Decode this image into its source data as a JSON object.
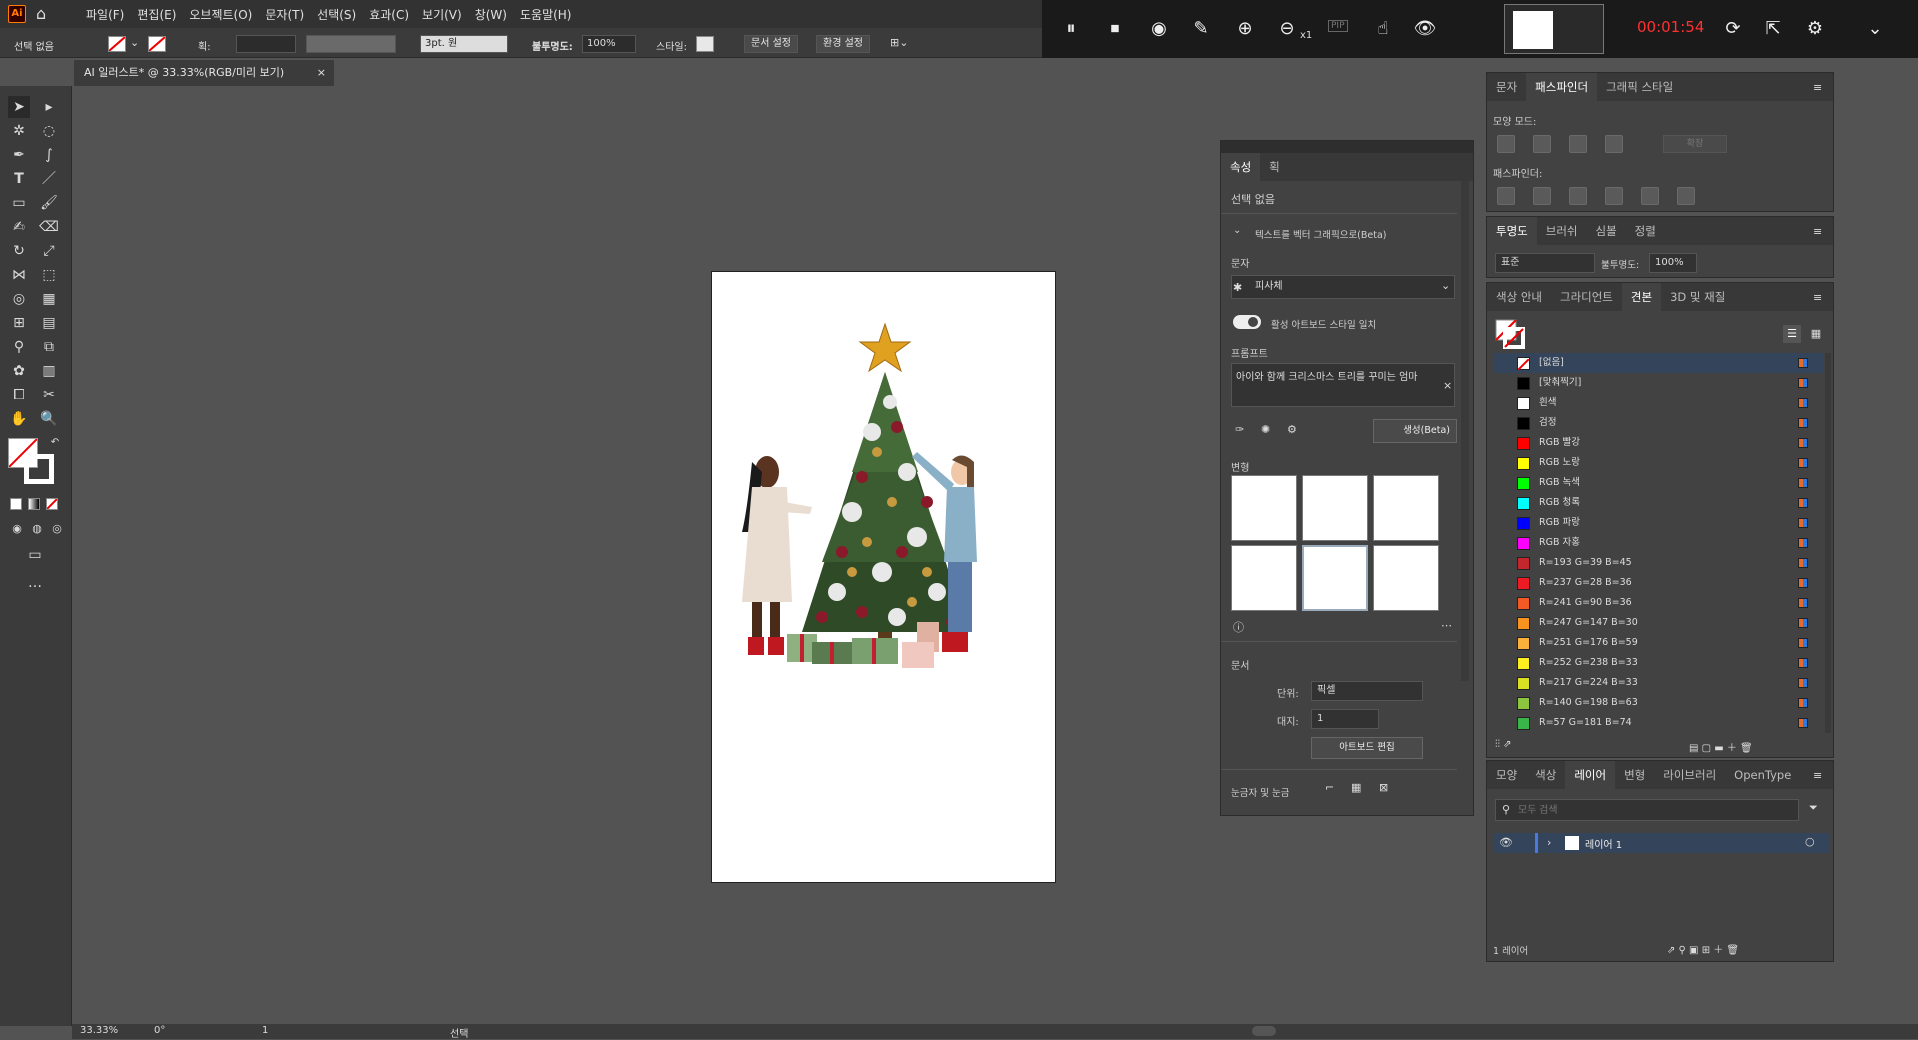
{
  "menu": {
    "items": [
      "파일(F)",
      "편집(E)",
      "오브젝트(O)",
      "문자(T)",
      "선택(S)",
      "효과(C)",
      "보기(V)",
      "창(W)",
      "도움말(H)"
    ]
  },
  "app_logo": "Ai",
  "recorder": {
    "time": "00:01:54",
    "zoom": "x1",
    "pip": "PIP"
  },
  "control_bar": {
    "selection": "선택 없음",
    "stroke_label": "획:",
    "stroke_style": "3pt. 원",
    "opacity_label": "불투명도:",
    "opacity_value": "100%",
    "style_label": "스타일:",
    "doc_setup": "문서 설정",
    "prefs": "환경 설정"
  },
  "document_tab": {
    "title": "AI 일러스트* @ 33.33%(RGB/미리 보기)"
  },
  "properties_panel": {
    "tabs": [
      "속성",
      "획"
    ],
    "selection": "선택 없음",
    "section_vector": "텍스트를 벡터 그래픽으로(Beta)",
    "subject_label": "문자",
    "subject_value": "피사체",
    "match_style": "활성 아트보드 스타일 일치",
    "prompt_label": "프롬프트",
    "prompt_text": "아이와 함께 크리스마스 트리를 꾸미는 엄마",
    "generate": "생성(Beta)",
    "variations_label": "변형",
    "document_label": "문서",
    "unit_label": "단위:",
    "unit_value": "픽셀",
    "artboard_label": "대지:",
    "artboard_value": "1",
    "edit_artboard": "아트보드 편집",
    "rulers_label": "눈금자 및 눈금"
  },
  "pathfinder_panel": {
    "tabs": [
      "문자",
      "패스파인더",
      "그래픽 스타일"
    ],
    "shape_mode_label": "모양 모드:",
    "expand": "확장",
    "pathfinder_label": "패스파인더:"
  },
  "transparency_panel": {
    "tabs": [
      "투명도",
      "브러쉬",
      "심볼",
      "정렬"
    ],
    "mode": "표준",
    "opacity_label": "불투명도:",
    "opacity_value": "100%"
  },
  "swatches_panel": {
    "tabs": [
      "색상 안내",
      "그라디언트",
      "견본",
      "3D 및 재질"
    ],
    "items": [
      {
        "name": "[없음]",
        "color": "none"
      },
      {
        "name": "[맞춰찍기]",
        "color": "#000000"
      },
      {
        "name": "흰색",
        "color": "#ffffff"
      },
      {
        "name": "검정",
        "color": "#000000"
      },
      {
        "name": "RGB 빨강",
        "color": "#ff0000"
      },
      {
        "name": "RGB 노랑",
        "color": "#ffff00"
      },
      {
        "name": "RGB 녹색",
        "color": "#00ff00"
      },
      {
        "name": "RGB 청록",
        "color": "#00ffff"
      },
      {
        "name": "RGB 파랑",
        "color": "#0000ff"
      },
      {
        "name": "RGB 자홍",
        "color": "#ff00ff"
      },
      {
        "name": "R=193 G=39 B=45",
        "color": "#c1272d"
      },
      {
        "name": "R=237 G=28 B=36",
        "color": "#ed1c24"
      },
      {
        "name": "R=241 G=90 B=36",
        "color": "#f15a24"
      },
      {
        "name": "R=247 G=147 B=30",
        "color": "#f7931e"
      },
      {
        "name": "R=251 G=176 B=59",
        "color": "#fbb03b"
      },
      {
        "name": "R=252 G=238 B=33",
        "color": "#fcee21"
      },
      {
        "name": "R=217 G=224 B=33",
        "color": "#d9e021"
      },
      {
        "name": "R=140 G=198 B=63",
        "color": "#8cc63f"
      },
      {
        "name": "R=57 G=181 B=74",
        "color": "#39b54a"
      }
    ]
  },
  "layers_panel": {
    "tabs": [
      "모양",
      "색상",
      "레이어",
      "변형",
      "라이브러리",
      "OpenType"
    ],
    "search_placeholder": "모두 검색",
    "layer_name": "레이어 1",
    "count": "1 레이어"
  },
  "status_bar": {
    "zoom": "33.33%",
    "rotation": "0°",
    "artboard": "1",
    "mode": "선택"
  }
}
